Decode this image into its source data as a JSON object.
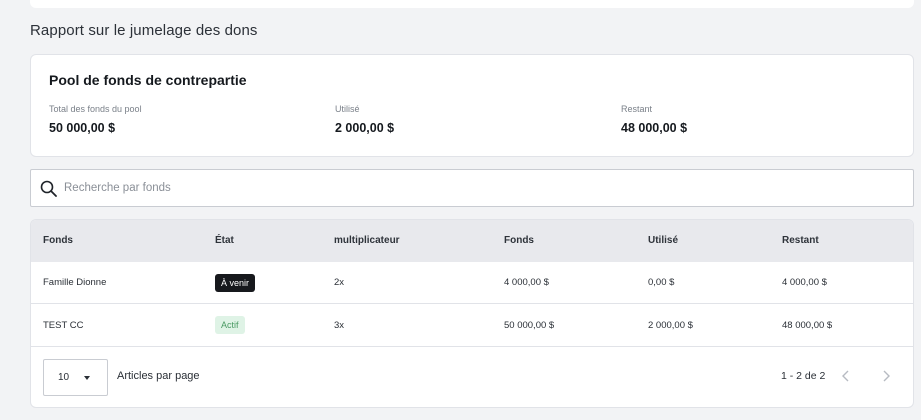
{
  "page": {
    "title": "Rapport sur le jumelage des dons"
  },
  "pool": {
    "title": "Pool de fonds de contrepartie",
    "stats": [
      {
        "label": "Total des fonds du pool",
        "value": "50 000,00 $"
      },
      {
        "label": "Utilisé",
        "value": "2 000,00 $"
      },
      {
        "label": "Restant",
        "value": "48 000,00 $"
      }
    ]
  },
  "search": {
    "placeholder": "Recherche par fonds",
    "value": ""
  },
  "table": {
    "columns": [
      "Fonds",
      "État",
      "multiplicateur",
      "Fonds",
      "Utilisé",
      "Restant"
    ],
    "rows": [
      {
        "fund": "Famille Dionne",
        "status": "À venir",
        "multiplier": "2x",
        "funds": "4 000,00 $",
        "used": "0,00 $",
        "remaining": "4 000,00 $"
      },
      {
        "fund": "TEST CC",
        "status": "Actif",
        "multiplier": "3x",
        "funds": "50 000,00 $",
        "used": "2 000,00 $",
        "remaining": "48 000,00 $"
      }
    ]
  },
  "pagination": {
    "per_page_value": "10",
    "per_page_label": "Articles par page",
    "range": "1 - 2 de 2"
  },
  "colors": {
    "status_upcoming_bg": "#17191d",
    "status_active_bg": "#dff3e6",
    "status_active_text": "#4a9a63",
    "header_bg": "#e8e9ed"
  }
}
